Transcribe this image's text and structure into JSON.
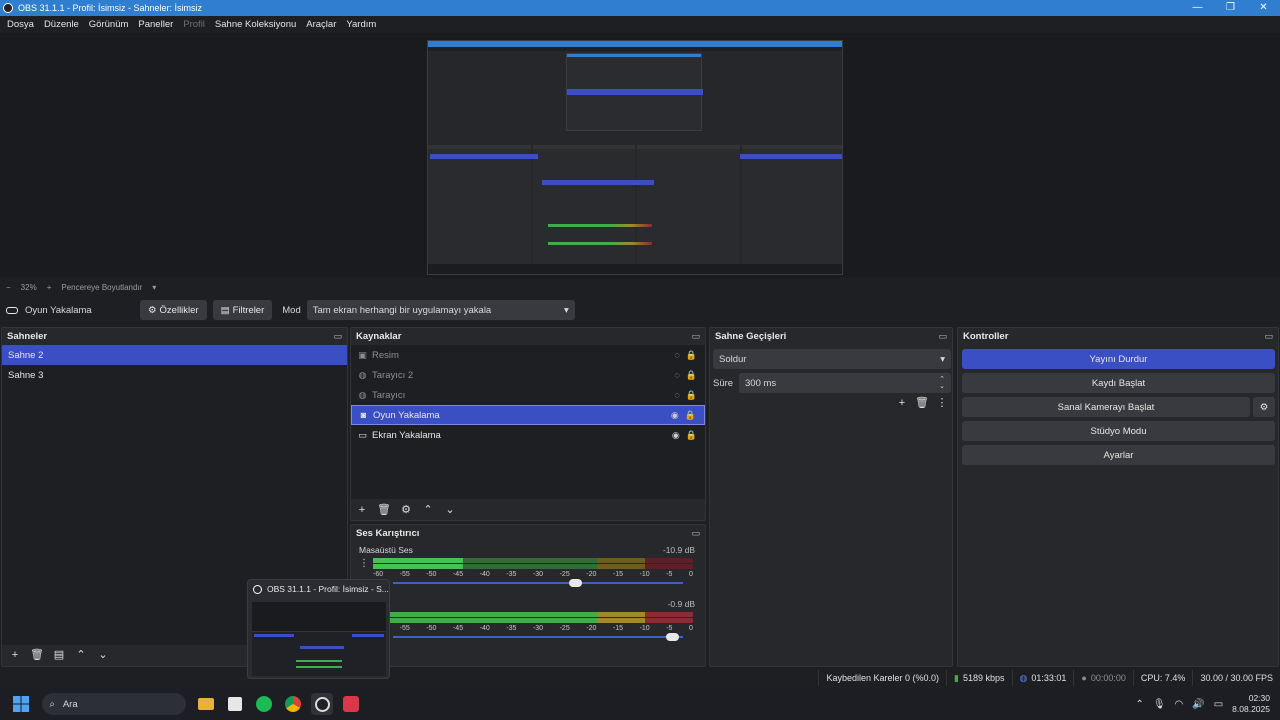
{
  "window": {
    "title": "OBS 31.1.1 - Profil: İsimsiz - Sahneler: İsimsiz"
  },
  "menu": {
    "items": [
      "Dosya",
      "Düzenle",
      "Görünüm",
      "Paneller",
      "Profil",
      "Sahne Koleksiyonu",
      "Araçlar",
      "Yardım"
    ]
  },
  "preview_bar": {
    "zoom_out": "−",
    "zoom": "32%",
    "zoom_in": "+",
    "fit": "Pencereye Boyutlandır"
  },
  "source_toolbar": {
    "source_name": "Oyun Yakalama",
    "properties": "Özellikler",
    "filters": "Filtreler",
    "mode_label": "Mod",
    "mode_value": "Tam ekran herhangi bir uygulamayı yakala"
  },
  "scenes": {
    "title": "Sahneler",
    "items": [
      "Sahne 2",
      "Sahne 3"
    ],
    "selected": "Sahne 2"
  },
  "sources": {
    "title": "Kaynaklar",
    "items": [
      {
        "label": "Resim",
        "visible": false,
        "icon": "image-icon"
      },
      {
        "label": "Tarayıcı 2",
        "visible": false,
        "icon": "globe-icon"
      },
      {
        "label": "Tarayıcı",
        "visible": false,
        "icon": "globe-icon"
      },
      {
        "label": "Oyun Yakalama",
        "visible": true,
        "icon": "gamepad-icon"
      },
      {
        "label": "Ekran Yakalama",
        "visible": true,
        "icon": "monitor-icon"
      }
    ],
    "selected": "Oyun Yakalama"
  },
  "mixer": {
    "title": "Ses Karıştırıcı",
    "channels": [
      {
        "name": "Masaüstü Ses",
        "db": "-10.9 dB",
        "level": 0.3,
        "peak": 0.6,
        "volume": 0.73
      },
      {
        "name": "",
        "db": "-0.9 dB",
        "level": 0.95,
        "peak": 0.96,
        "volume": 0.95
      }
    ],
    "ticks": [
      "-60",
      "-55",
      "-50",
      "-45",
      "-40",
      "-35",
      "-30",
      "-25",
      "-20",
      "-15",
      "-10",
      "-5",
      "0"
    ]
  },
  "transitions": {
    "title": "Sahne Geçişleri",
    "transition": "Soldur",
    "duration_label": "Süre",
    "duration_value": "300 ms"
  },
  "controls": {
    "title": "Kontroller",
    "stop_stream": "Yayını Durdur",
    "start_recording": "Kaydı Başlat",
    "start_virtualcam": "Sanal Kamerayı Başlat",
    "studio_mode": "Stüdyo Modu",
    "settings": "Ayarlar"
  },
  "status": {
    "dropped_frames": "Kaybedilen Kareler 0 (%0.0)",
    "bitrate": "5189 kbps",
    "stream_time": "01:33:01",
    "rec_time": "00:00:00",
    "cpu": "CPU: 7.4%",
    "fps": "30.00 / 30.00 FPS"
  },
  "hover_thumb": {
    "title": "OBS 31.1.1 - Profil: İsimsiz - S..."
  },
  "taskbar": {
    "search": "Ara",
    "time": "02:30",
    "date": "8.08.2025"
  },
  "colors": {
    "accent": "#3b4fc4",
    "titlebar": "#2f7ed0",
    "meter_green": "#3fae4a",
    "meter_yellow": "#a08a28",
    "meter_red": "#8e2a33"
  }
}
